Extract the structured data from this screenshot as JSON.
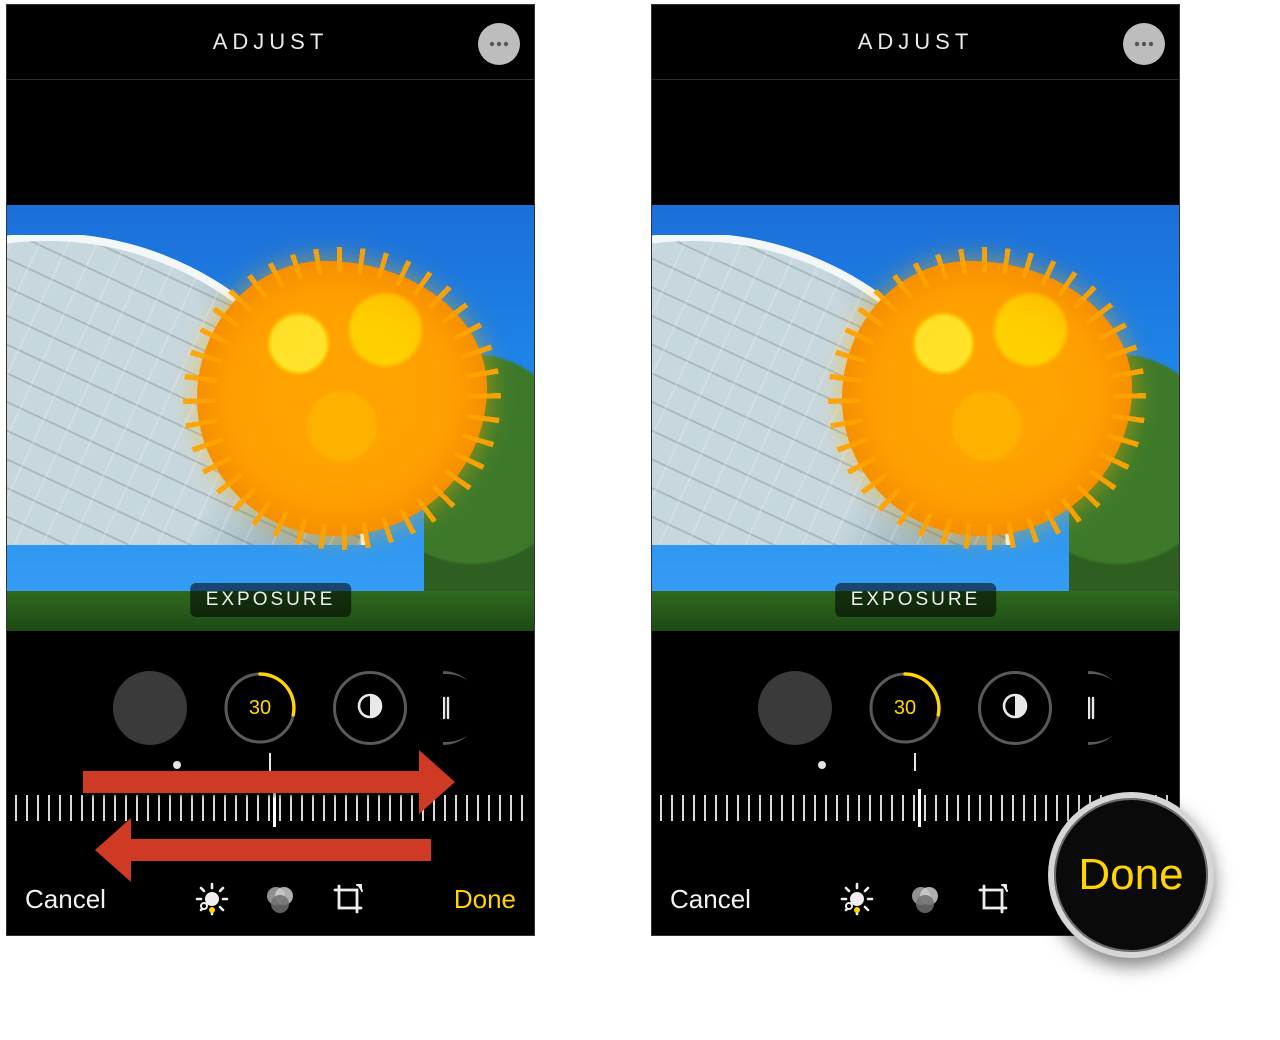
{
  "header": {
    "title": "ADJUST"
  },
  "adjustment": {
    "badge": "EXPOSURE",
    "active_value": "30",
    "tools": {
      "auto": "auto-enhance",
      "current": "exposure",
      "next1": "brilliance",
      "next2": "highlights"
    }
  },
  "footer": {
    "cancel": "Cancel",
    "done": "Done"
  },
  "photo": {
    "subject": "glass greenhouse with yellow chihuly sculpture",
    "icon_more": "more-icon",
    "icon_wand": "wand-icon",
    "icon_brilliance": "brilliance-icon",
    "icon_highlights": "highlights-icon",
    "icon_adjust": "adjust-mode-icon",
    "icon_filters": "filters-mode-icon",
    "icon_crop": "crop-mode-icon"
  },
  "colors": {
    "accent": "#ffd400",
    "arrow": "#cf3a25"
  },
  "callout": {
    "done_zoom": "Done"
  }
}
